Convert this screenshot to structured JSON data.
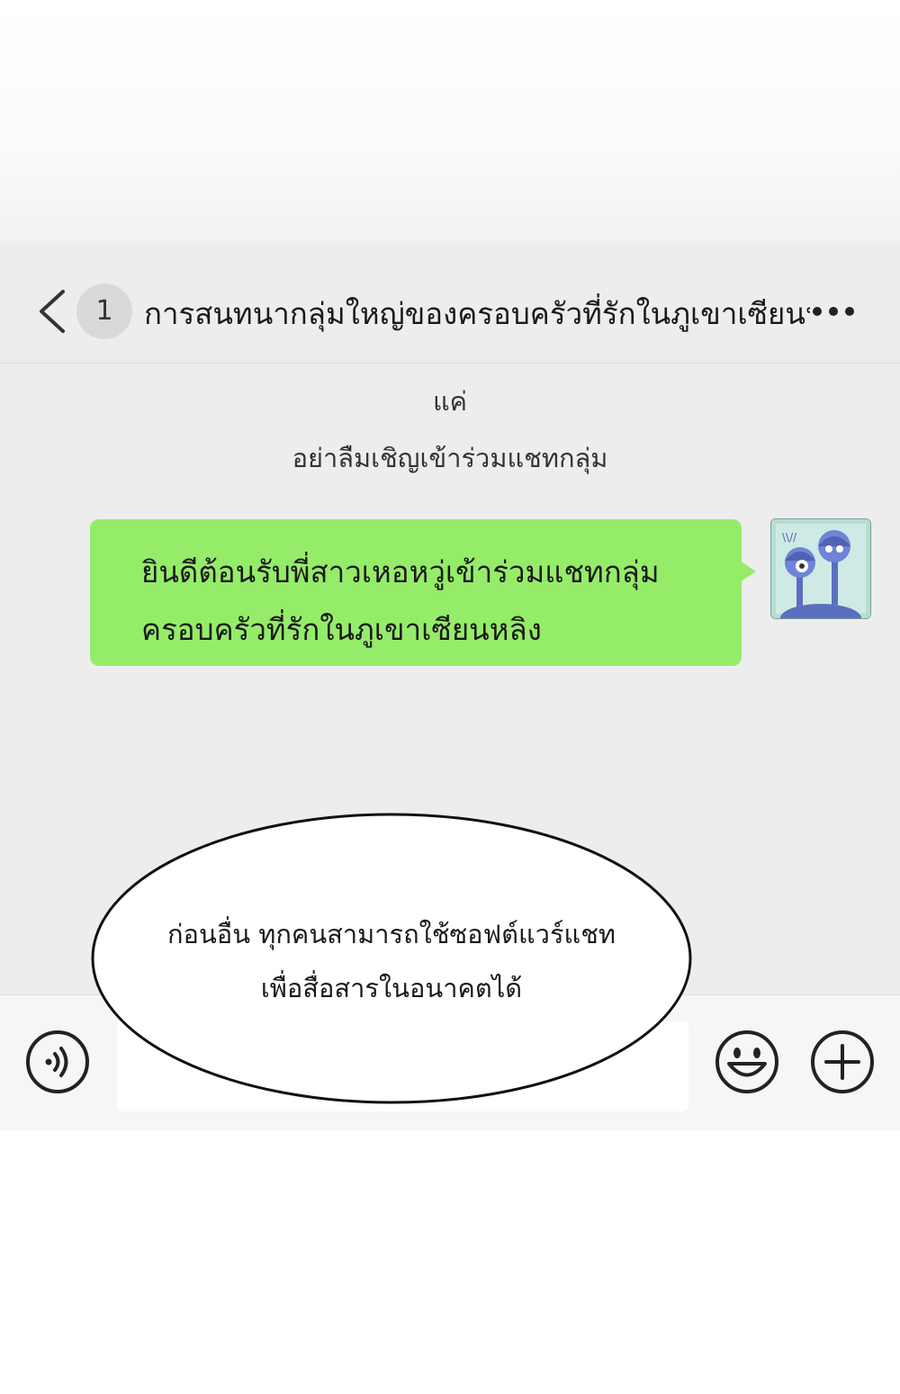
{
  "header": {
    "back_icon": "chevron-left-icon",
    "unread_count": "1",
    "title": "การสนทนากลุ่มใหญ่ของครอบครัวที่รักในภูเขาเซียนหลิง",
    "more_icon": "ellipsis-icon"
  },
  "system_messages": [
    "แค่",
    "อย่าลืมเชิญเข้าร่วมแชทกลุ่ม"
  ],
  "message": {
    "lines": [
      "ยินดีต้อนรับพี่สาวเหอหวู่เข้าร่วมแชทกลุ่ม",
      "ครอบครัวที่รักในภูเขาเซียนหลิง"
    ],
    "bubble_color": "#95ec69",
    "avatar_icon": "cartoon-avatar-icon"
  },
  "input_bar": {
    "voice_icon": "voice-icon",
    "emoji_icon": "smiley-icon",
    "plus_icon": "plus-icon"
  },
  "narration": {
    "lines": [
      "ก่อนอื่น ทุกคนสามารถใช้ซอฟต์แวร์แชท",
      "เพื่อสื่อสารในอนาคตได้"
    ]
  }
}
